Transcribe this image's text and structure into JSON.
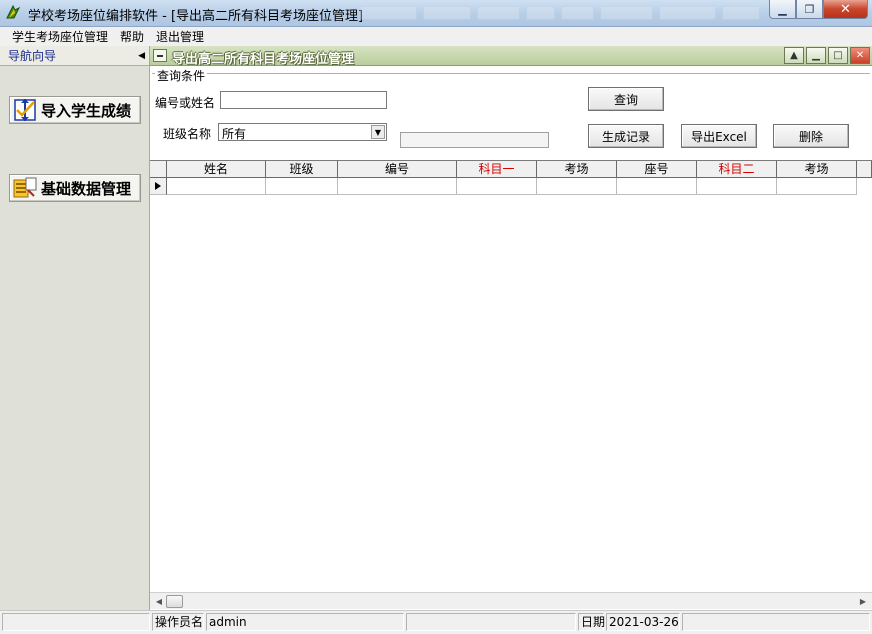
{
  "window": {
    "title": "学校考场座位编排软件   - [导出高二所有科目考场座位管理]",
    "min_icon": "minimize-icon",
    "max_icon": "maximize-icon",
    "close_icon": "close-icon"
  },
  "menu": {
    "items": [
      {
        "label": "学生考场座位管理"
      },
      {
        "label": "帮助"
      },
      {
        "label": "退出管理"
      }
    ]
  },
  "nav": {
    "header": "导航向导",
    "items": [
      {
        "label": "导入学生成绩",
        "icon": "import-grades-icon"
      },
      {
        "label": "基础数据管理",
        "icon": "database-management-icon"
      }
    ]
  },
  "child": {
    "title": "导出高二所有科目考场座位管理",
    "group_label": "查询条件",
    "search_label": "编号或姓名",
    "search_value": "",
    "class_label": "班级名称",
    "class_value": "所有",
    "buttons": {
      "query": "查询",
      "generate": "生成记录",
      "export": "导出Excel",
      "delete": "删除"
    }
  },
  "grid": {
    "columns": [
      {
        "label": "姓名",
        "highlight": false
      },
      {
        "label": "班级",
        "highlight": false
      },
      {
        "label": "编号",
        "highlight": false
      },
      {
        "label": "科目一",
        "highlight": true
      },
      {
        "label": "考场",
        "highlight": false
      },
      {
        "label": "座号",
        "highlight": false
      },
      {
        "label": "科目二",
        "highlight": true
      },
      {
        "label": "考场",
        "highlight": false
      }
    ],
    "highlight_color": "#d40000"
  },
  "status": {
    "operator_label": "操作员名",
    "operator_value": "admin",
    "date_label": "日期",
    "date_value": "2021-03-26"
  }
}
